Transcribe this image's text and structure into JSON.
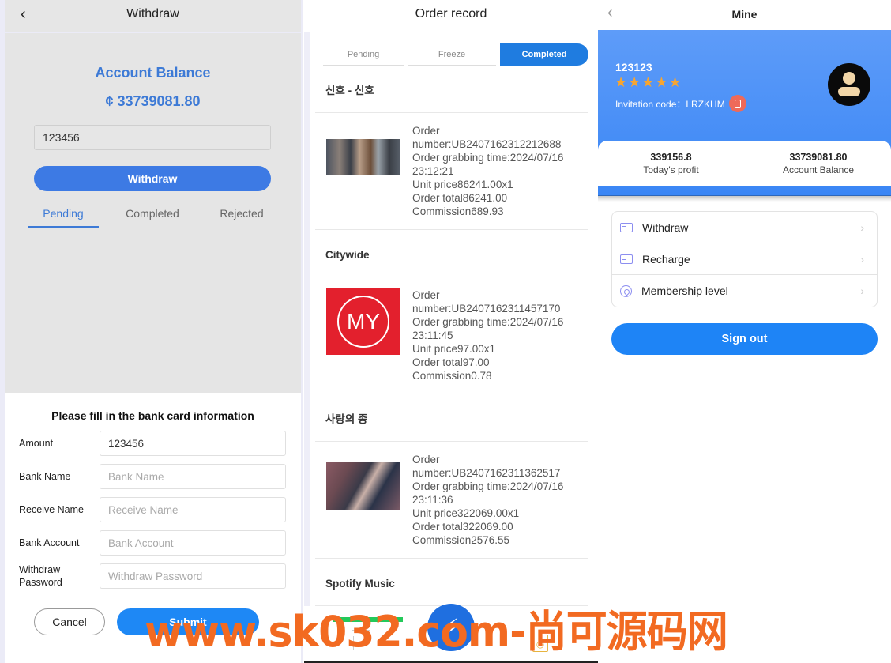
{
  "withdraw_screen": {
    "title": "Withdraw",
    "back_icon": "chevron-left-icon",
    "balance_label": "Account Balance",
    "balance_value": "¢ 33739081.80",
    "amount_input_value": "123456",
    "withdraw_button": "Withdraw",
    "tabs": [
      {
        "label": "Pending",
        "active": true
      },
      {
        "label": "Completed",
        "active": false
      },
      {
        "label": "Rejected",
        "active": false
      }
    ],
    "bank_form": {
      "title": "Please fill in the bank card information",
      "fields": [
        {
          "label": "Amount",
          "value": "123456",
          "placeholder": ""
        },
        {
          "label": "Bank Name",
          "value": "",
          "placeholder": "Bank Name"
        },
        {
          "label": "Receive Name",
          "value": "",
          "placeholder": "Receive Name"
        },
        {
          "label": "Bank Account",
          "value": "",
          "placeholder": "Bank Account"
        },
        {
          "label": "Withdraw Password",
          "value": "",
          "placeholder": "Withdraw Password"
        }
      ],
      "cancel_button": "Cancel",
      "submit_button": "Submit"
    }
  },
  "order_screen": {
    "title": "Order record",
    "tabs": [
      {
        "label": "Pending",
        "active": false
      },
      {
        "label": "Freeze",
        "active": false
      },
      {
        "label": "Completed",
        "active": true
      }
    ],
    "shops": [
      {
        "name": "신호 - 신호",
        "order": {
          "number": "Order number:UB2407162312212688",
          "time": "Order grabbing time:2024/07/16 23:12:21",
          "unit_price": "Unit price86241.00x1",
          "total": "Order total86241.00",
          "commission": "Commission689.93"
        }
      },
      {
        "name": "Citywide",
        "logo_text": "MY",
        "order": {
          "number": "Order number:UB2407162311457170",
          "time": "Order grabbing time:2024/07/16 23:11:45",
          "unit_price": "Unit price97.00x1",
          "total": "Order total97.00",
          "commission": "Commission0.78"
        }
      },
      {
        "name": "사랑의 종",
        "order": {
          "number": "Order number:UB2407162311362517",
          "time": "Order grabbing time:2024/07/16 23:11:36",
          "unit_price": "Unit price322069.00x1",
          "total": "Order total322069.00",
          "commission": "Commission2576.55"
        }
      },
      {
        "name": "Spotify Music"
      }
    ],
    "tabbar": {
      "icons": [
        "home-icon",
        "lightning-icon",
        "order-record-icon"
      ],
      "center_glyph": "⚡",
      "record_glyph": "◷"
    }
  },
  "mine_screen": {
    "title": "Mine",
    "back_icon": "chevron-left-icon",
    "username": "123123",
    "stars": "★★★★★",
    "star_count": 5,
    "invitation_label": "Invitation code：LRZKHM",
    "stats": [
      {
        "value": "339156.8",
        "label": "Today's profit"
      },
      {
        "value": "33739081.80",
        "label": "Account Balance"
      }
    ],
    "menu": [
      {
        "label": "Withdraw",
        "icon": "card-icon"
      },
      {
        "label": "Recharge",
        "icon": "card-icon"
      },
      {
        "label": "Membership level",
        "icon": "membership-icon"
      }
    ],
    "chevron": "›",
    "sign_out": "Sign out"
  },
  "watermark": "www.sk032.com-尚可源码网",
  "colors": {
    "primary_blue": "#3d7ae4",
    "accent_blue": "#1e84f6",
    "star_orange": "#f6a531",
    "watermark_orange": "#f26a21"
  }
}
